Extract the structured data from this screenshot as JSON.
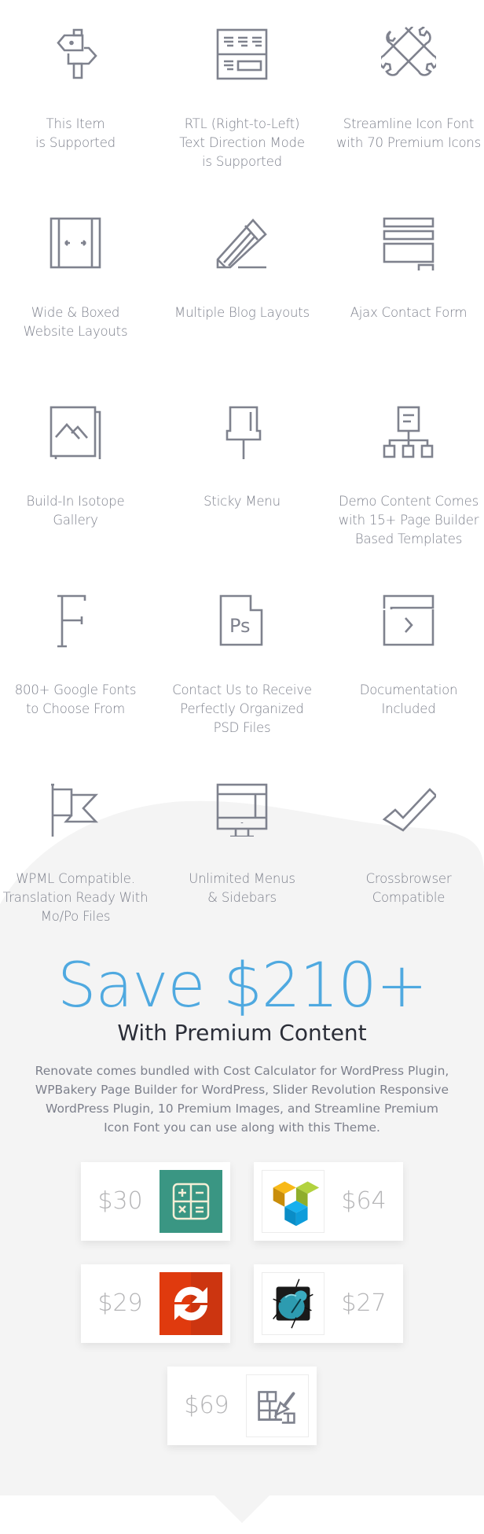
{
  "features": [
    {
      "icon": "signpost-icon",
      "label": [
        "This Item",
        "is Supported"
      ]
    },
    {
      "icon": "rtl-layout-icon",
      "label": [
        "RTL (Right-to-Left)",
        "Text Direction Mode",
        "is Supported"
      ]
    },
    {
      "icon": "wrenches-icon",
      "label": [
        "Streamline Icon Font",
        "with 70 Premium Icons"
      ]
    },
    {
      "icon": "wide-boxed-icon",
      "label": [
        "Wide & Boxed",
        "Website Layouts"
      ]
    },
    {
      "icon": "pencil-icon",
      "label": [
        "Multiple Blog Layouts"
      ]
    },
    {
      "icon": "contact-form-icon",
      "label": [
        "Ajax Contact Form"
      ]
    },
    {
      "icon": "gallery-icon",
      "label": [
        "Build-In Isotope",
        "Gallery"
      ]
    },
    {
      "icon": "pin-icon",
      "label": [
        "Sticky Menu"
      ]
    },
    {
      "icon": "sitemap-icon",
      "label": [
        "Demo Content Comes",
        "with 15+ Page Builder",
        "Based Templates"
      ]
    },
    {
      "icon": "font-icon",
      "label": [
        "800+ Google Fonts",
        "to Choose From"
      ]
    },
    {
      "icon": "psd-file-icon",
      "label": [
        "Contact Us to Receive",
        "Perfectly Organized",
        "PSD Files"
      ]
    },
    {
      "icon": "documentation-icon",
      "label": [
        "Documentation",
        "Included"
      ]
    },
    {
      "icon": "flag-icon",
      "label": [
        "WPML Compatible.",
        "Translation Ready With",
        "Mo/Po Files"
      ]
    },
    {
      "icon": "monitor-icon",
      "label": [
        "Unlimited Menus",
        "& Sidebars"
      ]
    },
    {
      "icon": "checkmark-icon",
      "label": [
        "Crossbrowser",
        "Compatible"
      ]
    }
  ],
  "psd_glyph": "Ps",
  "promo": {
    "title": "Save $210+",
    "subtitle": "With Premium Content",
    "description": "Renovate comes bundled with Cost Calculator for WordPress Plugin, WPBakery Page Builder for WordPress, Slider Revolution Responsive WordPress Plugin, 10 Premium Images, and Streamline Premium Icon Font you can use along with this Theme.",
    "accent_color": "#4fa9e0"
  },
  "bundles": [
    {
      "name": "cost-calculator",
      "price": "$30",
      "icon": "calculator-icon",
      "tile_color": "#3a9683"
    },
    {
      "name": "wpbakery-page-builder",
      "price": "$64",
      "icon": "visual-composer-logo-icon",
      "tile_color": "#ffffff"
    },
    {
      "name": "slider-revolution",
      "price": "$29",
      "icon": "refresh-arrows-icon",
      "tile_color": "#e03a0e"
    },
    {
      "name": "bug-plugin",
      "price": "$27",
      "icon": "scarab-bug-icon",
      "tile_color": "#ffffff"
    },
    {
      "name": "renovate-images",
      "price": "$69",
      "icon": "brick-trowel-icon",
      "tile_color": "#ffffff"
    }
  ]
}
